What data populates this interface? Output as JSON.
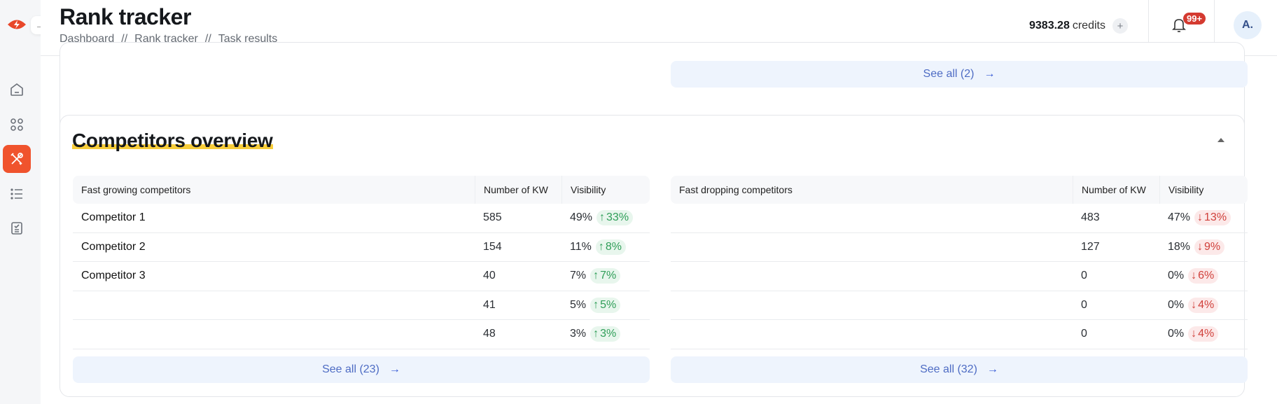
{
  "header": {
    "title": "Rank tracker",
    "breadcrumb": [
      "Dashboard",
      "Rank tracker",
      "Task results"
    ],
    "breadcrumb_separator": "//",
    "credits_value": "9383.28",
    "credits_label": "credits",
    "add_credits_icon": "+",
    "notification_badge": "99+",
    "avatar_initials": "A.",
    "expand_icon": "→"
  },
  "sidebar": {
    "items": [
      {
        "name": "home",
        "active": false
      },
      {
        "name": "apps",
        "active": false
      },
      {
        "name": "tools",
        "active": true
      },
      {
        "name": "list",
        "active": false
      },
      {
        "name": "tasks",
        "active": false
      }
    ]
  },
  "top_card": {
    "see_all_label": "See all (2)"
  },
  "competitors": {
    "title": "Competitors overview",
    "arrow": "→",
    "growing": {
      "headers": [
        "Fast growing competitors",
        "Number of KW",
        "Visibility"
      ],
      "rows": [
        {
          "name": "Competitor 1",
          "kw": "585",
          "visibility": "49%",
          "delta": "33%"
        },
        {
          "name": "Competitor 2",
          "kw": "154",
          "visibility": "11%",
          "delta": "8%"
        },
        {
          "name": "Competitor 3",
          "kw": "40",
          "visibility": "7%",
          "delta": "7%"
        },
        {
          "name": "",
          "kw": "41",
          "visibility": "5%",
          "delta": "5%"
        },
        {
          "name": "",
          "kw": "48",
          "visibility": "3%",
          "delta": "3%"
        }
      ],
      "see_all_label": "See all (23)"
    },
    "dropping": {
      "headers": [
        "Fast dropping competitors",
        "Number of KW",
        "Visibility"
      ],
      "rows": [
        {
          "name": "",
          "kw": "483",
          "visibility": "47%",
          "delta": "13%"
        },
        {
          "name": "",
          "kw": "127",
          "visibility": "18%",
          "delta": "9%"
        },
        {
          "name": "",
          "kw": "0",
          "visibility": "0%",
          "delta": "6%"
        },
        {
          "name": "",
          "kw": "0",
          "visibility": "0%",
          "delta": "4%"
        },
        {
          "name": "",
          "kw": "0",
          "visibility": "0%",
          "delta": "4%"
        }
      ],
      "see_all_label": "See all (32)"
    }
  },
  "colors": {
    "accent": "#f0532d",
    "positive": "#2f9e58",
    "negative": "#d0403b",
    "link": "#4e6cc4",
    "highlight": "#f7cd3a"
  }
}
